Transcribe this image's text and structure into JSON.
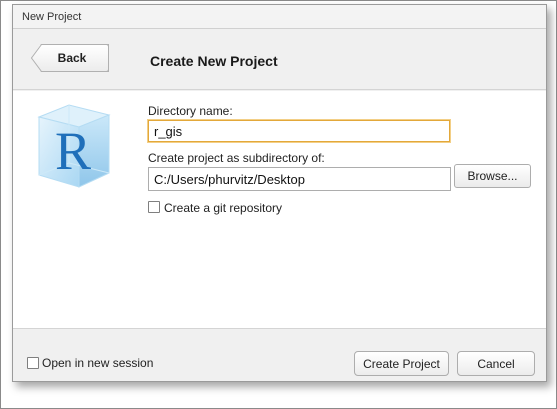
{
  "window": {
    "title": "New Project"
  },
  "header": {
    "back_label": "Back",
    "title": "Create New Project"
  },
  "form": {
    "directory_name_label": "Directory name:",
    "directory_name_value": "r_gis",
    "subdirectory_label": "Create project as subdirectory of:",
    "subdirectory_value": "C:/Users/phurvitz/Desktop",
    "browse_label": "Browse...",
    "git_repo_label": "Create a git repository",
    "git_repo_checked": false
  },
  "footer": {
    "open_new_session_label": "Open in new session",
    "open_new_session_checked": false,
    "create_label": "Create Project",
    "cancel_label": "Cancel"
  },
  "logo": {
    "letter": "R"
  },
  "colors": {
    "focus_border": "#e3a83a",
    "logo_letter": "#1f6fba",
    "logo_cube": "#9fd0f0"
  },
  "icons": {
    "logo": "r-cube-logo-icon",
    "back": "back-arrow-button"
  }
}
